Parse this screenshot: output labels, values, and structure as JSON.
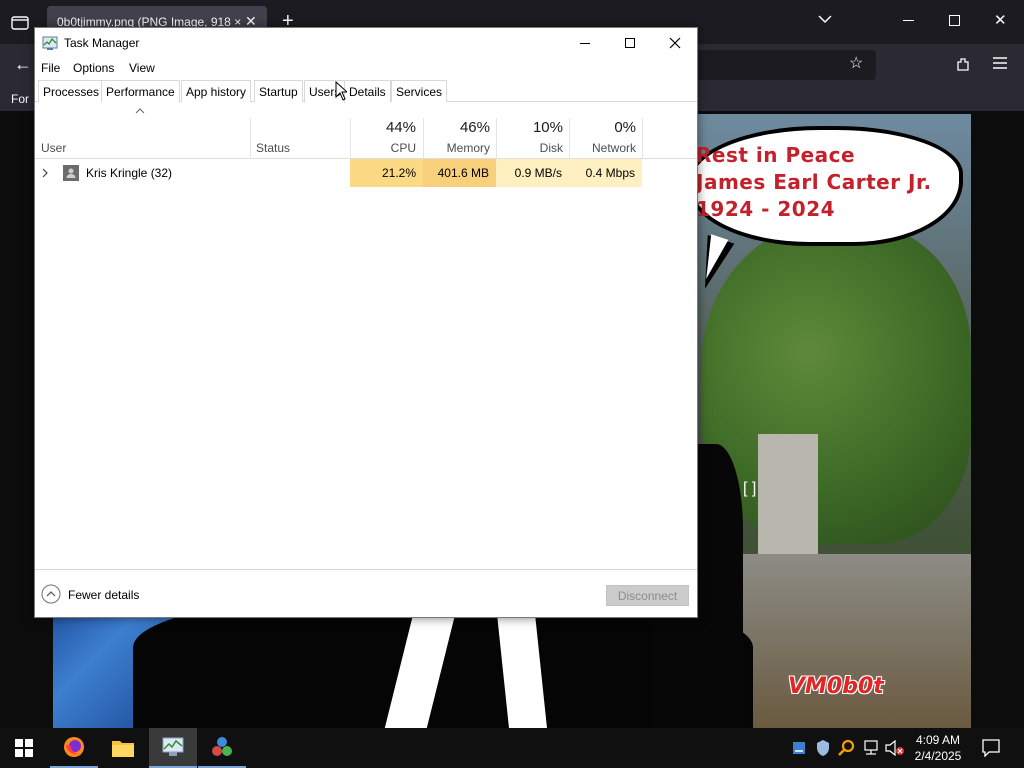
{
  "browser": {
    "tab_title": "0b0tjimmy.png (PNG Image, 918 ×",
    "bookmark_label": "For"
  },
  "image": {
    "bubble_lines": [
      "Rest in Peace",
      "James Earl Carter Jr.",
      "1924 - 2024"
    ],
    "watermark": "VM0b0t",
    "bracket_text": "[ ]"
  },
  "task_manager": {
    "title": "Task Manager",
    "menu": [
      "File",
      "Options",
      "View"
    ],
    "tabs": [
      "Processes",
      "Performance",
      "App history",
      "Startup",
      "Users",
      "Details",
      "Services"
    ],
    "active_tab": "Users",
    "columns": {
      "user": "User",
      "status": "Status",
      "cpu": {
        "pct": "44%",
        "label": "CPU"
      },
      "memory": {
        "pct": "46%",
        "label": "Memory"
      },
      "disk": {
        "pct": "10%",
        "label": "Disk"
      },
      "network": {
        "pct": "0%",
        "label": "Network"
      }
    },
    "rows": [
      {
        "user": "Kris Kringle (32)",
        "status": "",
        "cpu": "21.2%",
        "memory": "401.6 MB",
        "disk": "0.9 MB/s",
        "network": "0.4 Mbps"
      }
    ],
    "fewer_details": "Fewer details",
    "disconnect": "Disconnect"
  },
  "colors": {
    "heat_cpu": "#fcd984",
    "heat_memory": "#f8d07c",
    "heat_disk": "#fff0c1",
    "heat_network": "#fff0c1"
  },
  "taskbar": {
    "time": "4:09 AM",
    "date": "2/4/2025",
    "apps": [
      "start-icon",
      "firefox-icon",
      "file-explorer-icon",
      "task-manager-icon",
      "app-icon"
    ]
  }
}
